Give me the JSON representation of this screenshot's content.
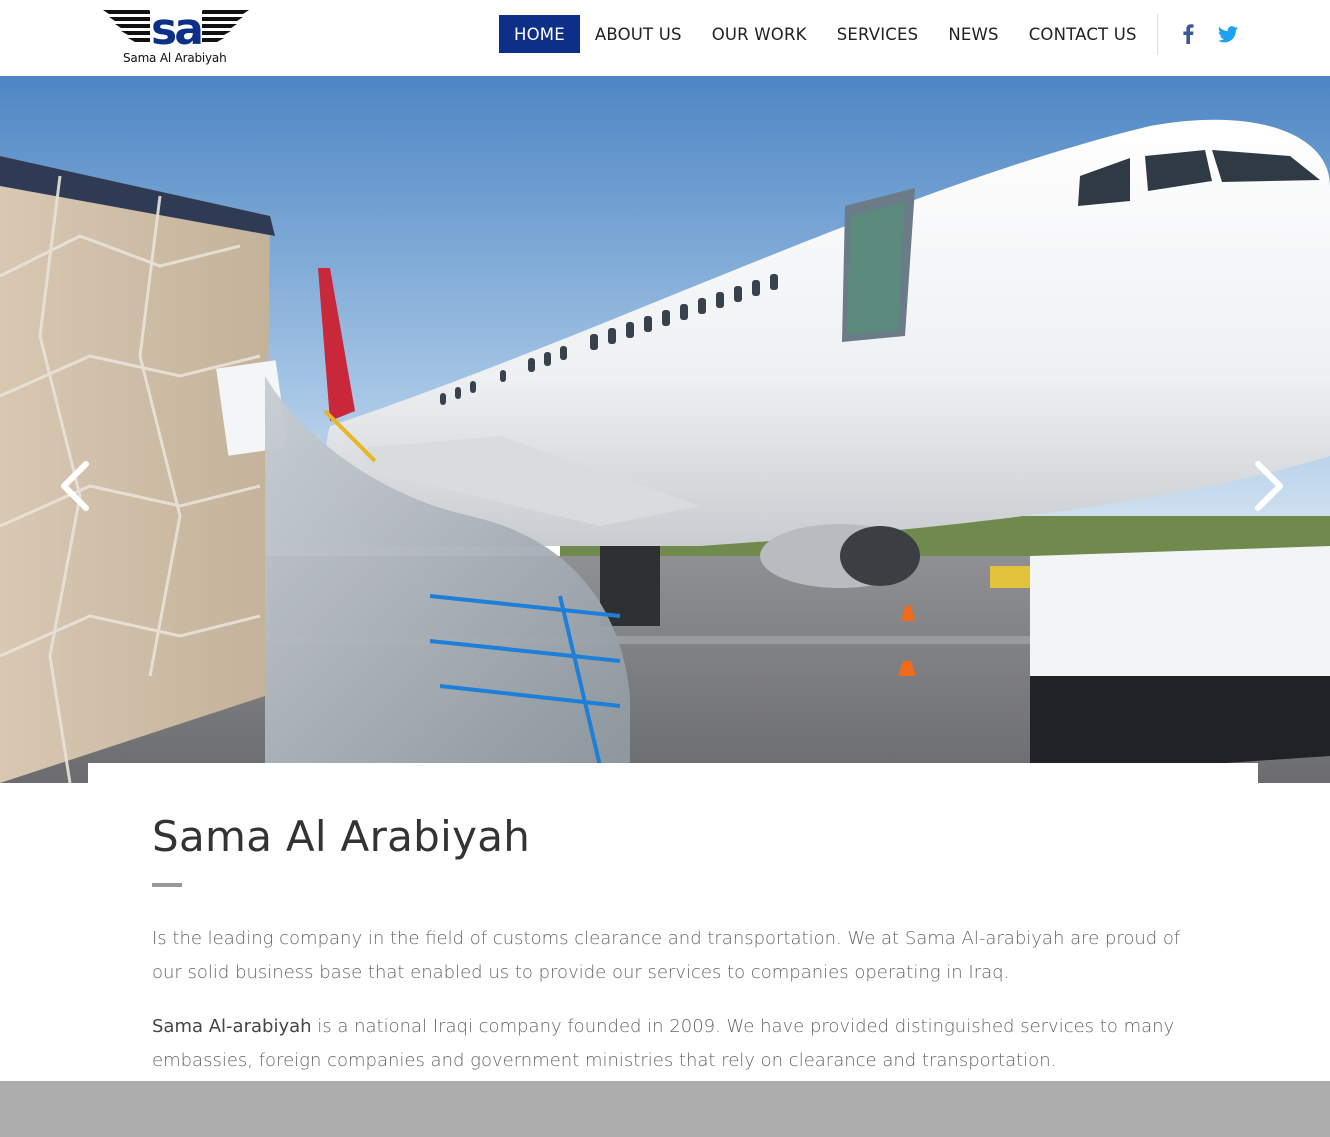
{
  "brand": {
    "logo_initials": "sa",
    "logo_text": "Sama Al Arabiyah",
    "brand_color": "#0e2f87"
  },
  "nav": {
    "items": [
      {
        "label": "HOME",
        "active": true
      },
      {
        "label": "ABOUT US",
        "active": false
      },
      {
        "label": "OUR WORK",
        "active": false
      },
      {
        "label": "SERVICES",
        "active": false
      },
      {
        "label": "NEWS",
        "active": false
      },
      {
        "label": "CONTACT US",
        "active": false
      }
    ],
    "social": [
      {
        "icon": "facebook-icon",
        "color": "#3b5998"
      },
      {
        "icon": "twitter-icon",
        "color": "#1da1f2"
      }
    ]
  },
  "hero": {
    "image": "cargo-airplane-photo",
    "prev_icon": "chevron-left-icon",
    "next_icon": "chevron-right-icon"
  },
  "content": {
    "title": "Sama Al Arabiyah",
    "paragraph_1": "Is the leading company in the field of customs clearance and transportation. We at Sama Al-arabiyah are proud of our solid business base that enabled us to provide our services to companies operating in Iraq.",
    "paragraph_2_strong": "Sama Al-arabiyah",
    "paragraph_2_rest": " is a national Iraqi company founded in 2009. We have provided distinguished services to many embassies, foreign companies and government ministries that rely on clearance and transportation."
  }
}
